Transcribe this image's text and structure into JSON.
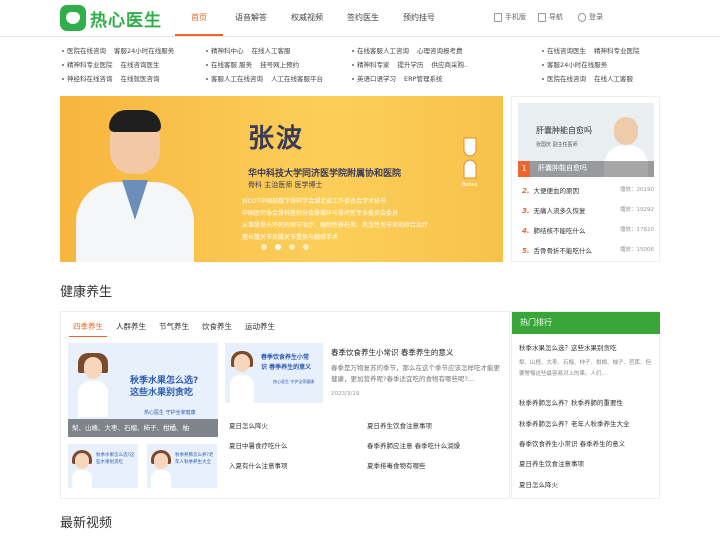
{
  "header": {
    "logo_text": "热心医生",
    "nav": [
      "首页",
      "语音解答",
      "权威视频",
      "签约医生",
      "预约挂号"
    ],
    "util": [
      "手机版",
      "导航",
      "登录"
    ]
  },
  "quick_links": {
    "row1": [
      [
        "医院在线咨询",
        "客服24小时在线服务"
      ],
      [
        "精神科中心",
        "在线人工客服"
      ],
      [
        "在线客服人工咨询",
        "心理咨询报考费"
      ],
      [
        "在线咨询医生",
        "精神科专业医院"
      ]
    ],
    "row2": [
      [
        "精神科专业医院",
        "在线咨询医生"
      ],
      [
        "在线客服 服务",
        "挂号网上预约"
      ],
      [
        "精神科专家",
        "提升学历",
        "供应商采购.."
      ],
      [
        "客服24小时在线服务"
      ]
    ],
    "row3": [
      [
        "神经科在线咨询",
        "在线就医咨询"
      ],
      [
        "客服人工在线咨询",
        "人工在线客服平台"
      ],
      [
        "英语口语学习",
        "ERP管理系统"
      ],
      [
        "医院在线咨询",
        "在线人工客服"
      ]
    ]
  },
  "banner": {
    "name": "张波",
    "hospital": "华中科技大学同济医学院附属协和医院",
    "title": "骨科  主治医师  医学博士",
    "bullets": [
      "SICOT中国部数字骨科学会湖北省工作委员会学术秘书",
      "中国医师协会骨科医师分会骨循环与骨坏死专业委员会委员",
      "从事股骨头坏死的保守治疗、强制性脊柱炎、风湿性关节炎的综合治疗",
      "擅长髋关节及膝关节置换与翻修手术"
    ],
    "bone_label": "Bones",
    "slides": 4,
    "active_slide": 1
  },
  "rank": {
    "featured_title": "肝囊肿能自愈吗",
    "featured_doctor": "张国庆 副主任医师",
    "featured_rank": "1",
    "featured_caption": "肝囊肿能自愈吗",
    "items": [
      {
        "num": "2.",
        "title": "大便便血的原因",
        "views": "播放：20190"
      },
      {
        "num": "3.",
        "title": "无痛人流多久恢复",
        "views": "播放：19292"
      },
      {
        "num": "4.",
        "title": "肺结核不能吃什么",
        "views": "播放：17820"
      },
      {
        "num": "5.",
        "title": "舌骨骨折不能吃什么",
        "views": "播放：15006"
      }
    ]
  },
  "health": {
    "section_title": "健康养生",
    "tabs": [
      "四季养生",
      "人群养生",
      "节气养生",
      "饮食养生",
      "运动养生"
    ],
    "big_card_text1": "秋季水果怎么选?",
    "big_card_text2": "这些水果别贪吃",
    "big_card_sub": "热心医生  守护全家健康",
    "big_card_caption": "梨、山楂、大枣、石榴、柿子、柑橘、柚",
    "small_card1": "秋季水果怎么选?这些水果别贪吃",
    "small_card2": "秋季养肺怎么养?老年人秋季养生大全",
    "article_card_text1": "春季饮食养生小常",
    "article_card_text2": "识 春季养生的意义",
    "article_card_sub": "热心医生  守护全家健康",
    "article_title": "春季饮食养生小常识 春季养生的意义",
    "article_desc": "春季是万物复苏的季节，那么在这个季节应该怎样吃才能更健康，更加营养呢?春季适宜吃的食物有哪些呢?...",
    "article_date": "2023/3/19",
    "links": [
      "夏日怎么降火",
      "夏日养生饮食注意事项",
      "夏日中暑食疗吃什么",
      "春季养肺应注意 春季吃什么润燥",
      "入夏有什么注意事项",
      "夏季排毒食物有哪些"
    ]
  },
  "hot": {
    "title": "热门排行",
    "items": [
      "秋季水果怎么选？这些水果别贪吃",
      "秋季养肺怎么养？秋季养肺的重要性",
      "秋季养肺怎么养？老年人秋季养生大全",
      "春季饮食养生小常识 春季养生的意义",
      "夏日养生饮食注意事项",
      "夏日怎么降火"
    ],
    "first_desc": "梨、山楂、大枣、石榴、柿子、柑橘、柚子、芭蕉、但要警惕这些最容易对上的果。人们..."
  },
  "video_section_title": "最新视频"
}
